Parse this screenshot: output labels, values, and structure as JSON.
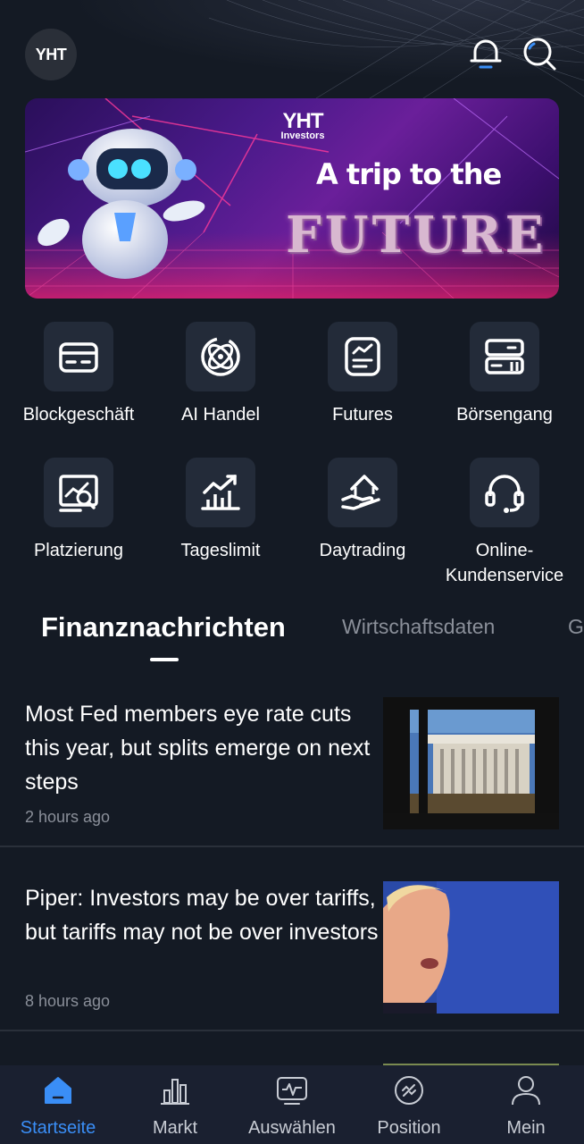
{
  "header": {
    "logo_text": "YHT",
    "bell_icon": "bell-icon",
    "search_icon": "search-icon"
  },
  "banner": {
    "brand": "YHT",
    "brand_sub": "Investors",
    "title": "A trip to the",
    "subtitle": "FUTURE"
  },
  "features": [
    {
      "label": "Blockgeschäft",
      "icon": "card-icon"
    },
    {
      "label": "AI Handel",
      "icon": "atom-icon"
    },
    {
      "label": "Futures",
      "icon": "chart-doc-icon"
    },
    {
      "label": "Börsengang",
      "icon": "server-icon"
    },
    {
      "label": "Platzierung",
      "icon": "analysis-icon"
    },
    {
      "label": "Tageslimit",
      "icon": "growth-chart-icon"
    },
    {
      "label": "Daytrading",
      "icon": "hand-house-icon"
    },
    {
      "label": "Online-Kundenservice",
      "icon": "headset-icon"
    }
  ],
  "tabs": [
    {
      "label": "Finanznachrichten",
      "active": true
    },
    {
      "label": "Wirtschaftsdaten",
      "active": false
    },
    {
      "label": "G",
      "active": false
    }
  ],
  "news": [
    {
      "title": "Most Fed members eye rate cuts this year, but splits emerge on next steps",
      "time": "2 hours ago"
    },
    {
      "title": "Piper: Investors may be over tariffs, but tariffs may not be over investors",
      "time": "8 hours ago"
    }
  ],
  "bottom_nav": [
    {
      "label": "Startseite",
      "icon": "home-icon",
      "active": true
    },
    {
      "label": "Markt",
      "icon": "bar-chart-icon",
      "active": false
    },
    {
      "label": "Auswählen",
      "icon": "monitor-pulse-icon",
      "active": false
    },
    {
      "label": "Position",
      "icon": "position-icon",
      "active": false
    },
    {
      "label": "Mein",
      "icon": "user-icon",
      "active": false
    }
  ],
  "colors": {
    "background": "#141a24",
    "accent": "#3a8ef6",
    "muted_text": "#8a8f99"
  }
}
